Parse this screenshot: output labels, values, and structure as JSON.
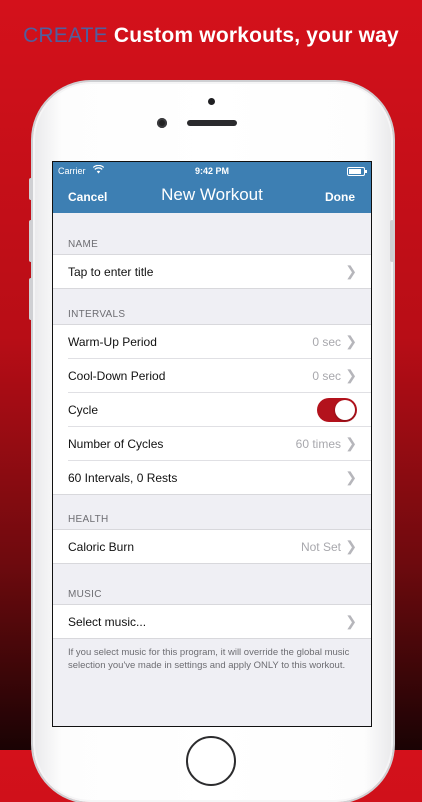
{
  "headline": {
    "keyword": "CREATE",
    "text": "Custom workouts, your way"
  },
  "status_bar": {
    "carrier": "Carrier",
    "time": "9:42 PM"
  },
  "nav": {
    "cancel": "Cancel",
    "title": "New Workout",
    "done": "Done"
  },
  "sections": {
    "name": {
      "header": "NAME",
      "rows": [
        {
          "label": "Tap to enter title"
        }
      ]
    },
    "intervals": {
      "header": "INTERVALS",
      "rows": [
        {
          "label": "Warm-Up Period",
          "value": "0 sec"
        },
        {
          "label": "Cool-Down Period",
          "value": "0 sec"
        },
        {
          "label": "Cycle",
          "toggle_on": true
        },
        {
          "label": "Number of Cycles",
          "value": "60 times"
        },
        {
          "label": "60 Intervals, 0 Rests"
        }
      ]
    },
    "health": {
      "header": "HEALTH",
      "rows": [
        {
          "label": "Caloric Burn",
          "value": "Not Set"
        }
      ]
    },
    "music": {
      "header": "MUSIC",
      "rows": [
        {
          "label": "Select music..."
        }
      ],
      "footnote": "If you select music for this program, it will override the global music selection you've made in settings and apply ONLY to this workout."
    }
  },
  "colors": {
    "nav_bar": "#3d7fb3",
    "toggle_on": "#b3121c",
    "headline_keyword": "#4f5f9e",
    "background_red": "#d4111b"
  },
  "icons": [
    "wifi-icon",
    "battery-icon",
    "chevron-right-icon"
  ]
}
